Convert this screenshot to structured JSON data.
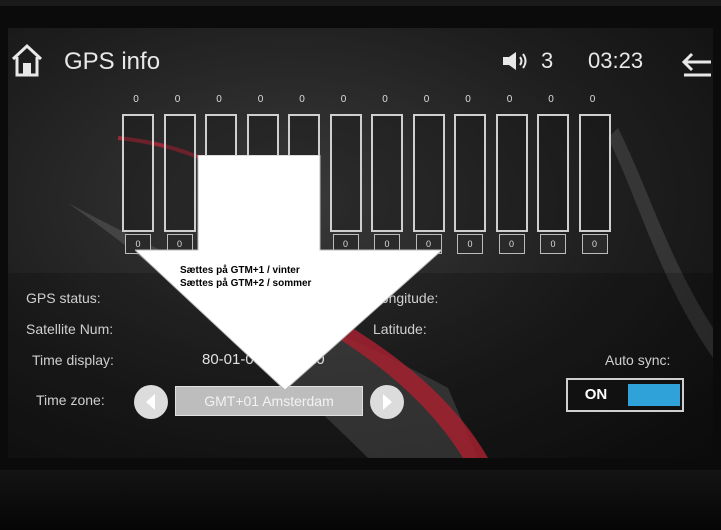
{
  "header": {
    "title": "GPS info",
    "volume": "3",
    "clock": "03:23",
    "icons": {
      "home": "home-icon",
      "speaker": "speaker-icon",
      "back": "back-arrow-icon"
    }
  },
  "sliders": [
    {
      "top_value": "0",
      "knob_value": "0"
    },
    {
      "top_value": "0",
      "knob_value": "0"
    },
    {
      "top_value": "0",
      "knob_value": "0"
    },
    {
      "top_value": "0",
      "knob_value": "0"
    },
    {
      "top_value": "0",
      "knob_value": "0"
    },
    {
      "top_value": "0",
      "knob_value": "0"
    },
    {
      "top_value": "0",
      "knob_value": "0"
    },
    {
      "top_value": "0",
      "knob_value": "0"
    },
    {
      "top_value": "0",
      "knob_value": "0"
    },
    {
      "top_value": "0",
      "knob_value": "0"
    },
    {
      "top_value": "0",
      "knob_value": "0"
    },
    {
      "top_value": "0",
      "knob_value": "0"
    }
  ],
  "info": {
    "gps_status_label": "GPS status:",
    "satellite_num_label": "Satellite Num:",
    "time_display_label": "Time display:",
    "time_display_value": "80-01-06 04:23:20",
    "time_zone_label": "Time zone:",
    "time_zone_value": "GMT+01 Amsterdam",
    "longitude_label": "Longitude:",
    "latitude_label": "Latitude:",
    "auto_sync_label": "Auto sync:",
    "auto_sync_state": "ON"
  },
  "annotation": {
    "line1": "Sættes på GTM+1 / vinter",
    "line2": "Sættes på GTM+2 / sommer"
  },
  "colors": {
    "accent": "#2fa2da",
    "swoosh_red": "#c8283a"
  }
}
